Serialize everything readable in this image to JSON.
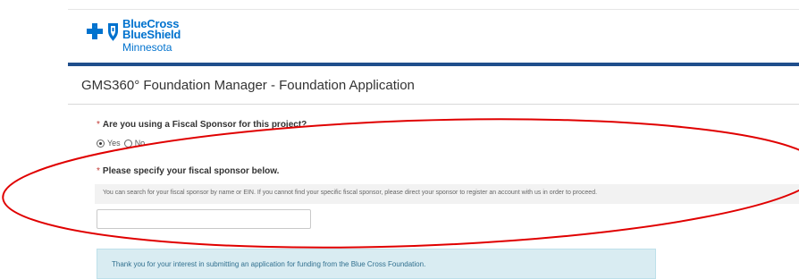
{
  "logo": {
    "line1": "BlueCross",
    "line2": "BlueShield",
    "line3": "Minnesota"
  },
  "page": {
    "title": "GMS360° Foundation Manager - Foundation Application"
  },
  "form": {
    "required_marker": "*",
    "question_fiscal_sponsor": "Are you using a Fiscal Sponsor for this project?",
    "options": [
      {
        "label": "Yes",
        "selected": true
      },
      {
        "label": "No",
        "selected": false
      }
    ],
    "question_specify_sponsor": "Please specify your fiscal sponsor below.",
    "help_text": "You can search for your fiscal sponsor by name or EIN. If you cannot find your specific fiscal sponsor, please direct your sponsor to register an account with us in order to proceed.",
    "sponsor_input_value": ""
  },
  "info": {
    "message": "Thank you for your interest in submitting an application for funding from the Blue Cross Foundation."
  },
  "colors": {
    "brand_blue": "#0072ce",
    "header_bar": "#1f4e8c",
    "required_red": "#c23934",
    "annotation_red": "#e00000",
    "info_bg": "#d9ecf2",
    "info_text": "#31708f"
  }
}
